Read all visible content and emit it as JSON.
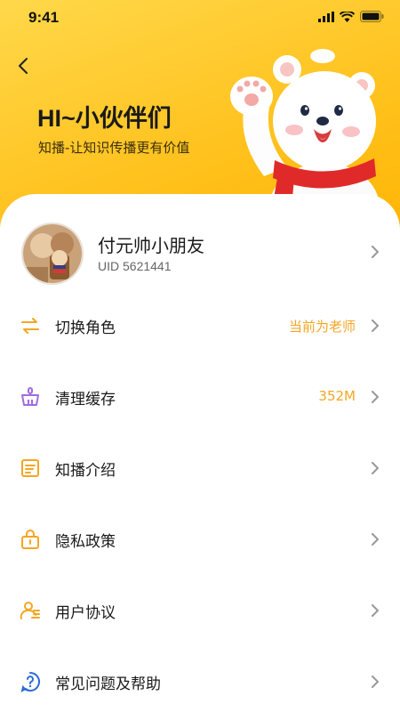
{
  "status_bar": {
    "time": "9:41"
  },
  "header": {
    "title": "HI~小伙伴们",
    "subtitle": "知播-让知识传播更有价值"
  },
  "profile": {
    "name": "付元帅小朋友",
    "uid": "UID 5621441"
  },
  "menu": [
    {
      "label": "切换角色",
      "value": "当前为老师",
      "icon": "swap-icon"
    },
    {
      "label": "清理缓存",
      "value": "352M",
      "icon": "broom-icon"
    },
    {
      "label": "知播介绍",
      "value": "",
      "icon": "document-icon"
    },
    {
      "label": "隐私政策",
      "value": "",
      "icon": "lock-icon"
    },
    {
      "label": "用户协议",
      "value": "",
      "icon": "user-icon"
    },
    {
      "label": "常见问题及帮助",
      "value": "",
      "icon": "help-icon"
    }
  ],
  "colors": {
    "accent": "#f5a623",
    "header": "#ffc21e",
    "icon_purple": "#a06be0"
  }
}
